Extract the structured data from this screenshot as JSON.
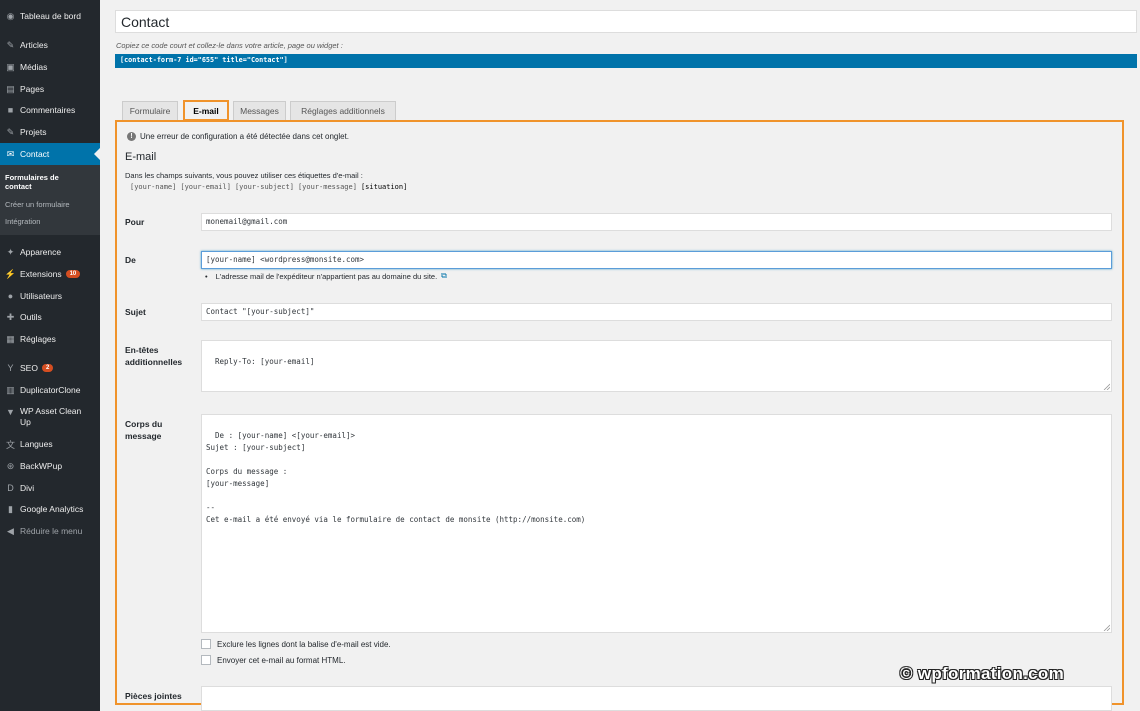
{
  "sidebar": {
    "items": [
      {
        "label": "Tableau de bord",
        "icon": "dashboard-icon",
        "glyph": "◉"
      },
      {
        "label": "Articles",
        "icon": "pin-icon",
        "glyph": "✎"
      },
      {
        "label": "Médias",
        "icon": "media-icon",
        "glyph": "▣"
      },
      {
        "label": "Pages",
        "icon": "page-icon",
        "glyph": "▤"
      },
      {
        "label": "Commentaires",
        "icon": "comment-icon",
        "glyph": "■"
      },
      {
        "label": "Projets",
        "icon": "pin-icon",
        "glyph": "✎"
      },
      {
        "label": "Contact",
        "icon": "envelope-icon",
        "glyph": "✉"
      },
      {
        "label": "Apparence",
        "icon": "brush-icon",
        "glyph": "✦"
      },
      {
        "label": "Extensions",
        "icon": "plugin-icon",
        "glyph": "⚡",
        "badge": "10"
      },
      {
        "label": "Utilisateurs",
        "icon": "users-icon",
        "glyph": "●"
      },
      {
        "label": "Outils",
        "icon": "wrench-icon",
        "glyph": "✚"
      },
      {
        "label": "Réglages",
        "icon": "settings-icon",
        "glyph": "▦"
      },
      {
        "label": "SEO",
        "icon": "seo-icon",
        "glyph": "Y",
        "badge": "2"
      },
      {
        "label": "DuplicatorClone",
        "icon": "duplicator-icon",
        "glyph": "▥"
      },
      {
        "label": "WP Asset Clean Up",
        "icon": "filter-icon",
        "glyph": "▼"
      },
      {
        "label": "Langues",
        "icon": "translate-icon",
        "glyph": "文"
      },
      {
        "label": "BackWPup",
        "icon": "backup-icon",
        "glyph": "⊛"
      },
      {
        "label": "Divi",
        "icon": "divi-icon",
        "glyph": "D"
      },
      {
        "label": "Google Analytics",
        "icon": "analytics-icon",
        "glyph": "▮"
      },
      {
        "label": "Réduire le menu",
        "icon": "collapse-icon",
        "glyph": "◀"
      }
    ],
    "submenu": [
      "Formulaires de contact",
      "Créer un formulaire",
      "Intégration"
    ]
  },
  "form_title": "Contact",
  "shortcode_hint": "Copiez ce code court et collez-le dans votre article, page ou widget :",
  "shortcode": "[contact-form-7 id=\"655\" title=\"Contact\"]",
  "tabs": [
    "Formulaire",
    "E-mail",
    "Messages",
    "Réglages additionnels"
  ],
  "notice": "Une erreur de configuration a été détectée dans cet onglet.",
  "section_title": "E-mail",
  "intro": "Dans les champs suivants, vous pouvez utiliser ces étiquettes d'e-mail :",
  "mail_tags": [
    "[your-name]",
    "[your-email]",
    "[your-subject]",
    "[your-message]",
    "[situation]"
  ],
  "fields": {
    "to": {
      "label": "Pour",
      "value": "monemail@gmail.com"
    },
    "from": {
      "label": "De",
      "value": "[your-name] <wordpress@monsite.com>",
      "note": "L'adresse mail de l'expéditeur n'appartient pas au domaine du site."
    },
    "subject": {
      "label": "Sujet",
      "value": "Contact \"[your-subject]\""
    },
    "headers": {
      "label": "En-têtes additionnelles",
      "value": "Reply-To: [your-email]"
    },
    "body": {
      "label": "Corps du message",
      "value": "De : [your-name] <[your-email]>\nSujet : [your-subject]\n\nCorps du message :\n[your-message]\n\n--\nCet e-mail a été envoyé via le formulaire de contact de monsite (http://monsite.com)"
    },
    "attachments": {
      "label": "Pièces jointes",
      "value": ""
    }
  },
  "checkboxes": [
    "Exclure les lignes dont la balise d'e-mail est vide.",
    "Envoyer cet e-mail au format HTML."
  ],
  "watermark": "© wpformation.com",
  "colors": {
    "sidebar": "#23282d",
    "active": "#0073aa",
    "highlight": "#f0932b"
  }
}
